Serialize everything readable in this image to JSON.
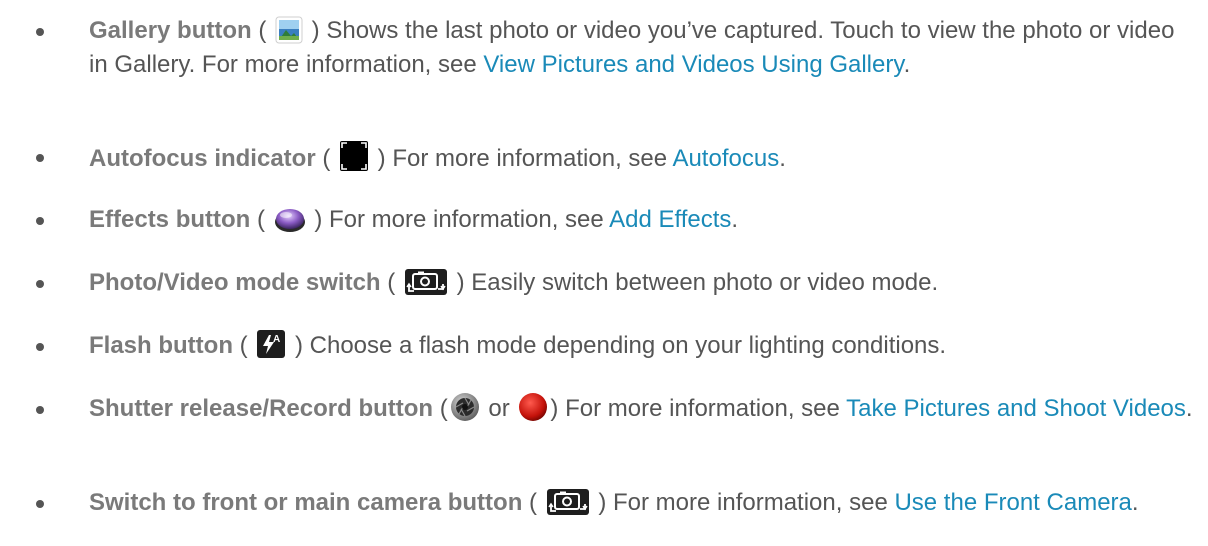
{
  "items": [
    {
      "term": "Gallery button",
      "icon": "gallery-thumbnail-icon",
      "text_before_link": "Shows the last photo or video you’ve captured. Touch to view the photo or video in Gallery. For more information, see ",
      "link": "View Pictures and Videos Using Gallery",
      "text_after_link": "."
    },
    {
      "term": "Autofocus indicator",
      "icon": "autofocus-frame-icon",
      "text_before_link": "For more information, see ",
      "link": "Autofocus",
      "text_after_link": "."
    },
    {
      "term": "Effects button",
      "icon": "effects-lens-icon",
      "text_before_link": "For more information, see ",
      "link": "Add Effects",
      "text_after_link": "."
    },
    {
      "term": "Photo/Video mode switch",
      "icon": "camera-switch-icon",
      "text_before_link": "Easily switch between photo or video mode.",
      "link": "",
      "text_after_link": ""
    },
    {
      "term": "Flash button",
      "icon": "flash-auto-icon",
      "text_before_link": "Choose a flash mode depending on your lighting conditions.",
      "link": "",
      "text_after_link": ""
    },
    {
      "term": "Shutter release/Record button",
      "icon": "shutter-icon",
      "connector": "or",
      "icon2": "record-icon",
      "text_before_link": "For more information, see ",
      "link": "Take Pictures and Shoot Videos",
      "text_after_link": "."
    },
    {
      "term": "Switch to front or main camera button",
      "icon": "camera-switch-icon",
      "text_before_link": "For more information, see ",
      "link": "Use the Front Camera",
      "text_after_link": "."
    }
  ],
  "colors": {
    "body_text": "#555555",
    "term_text": "#7a7a7a",
    "link": "#1a8ab8"
  }
}
